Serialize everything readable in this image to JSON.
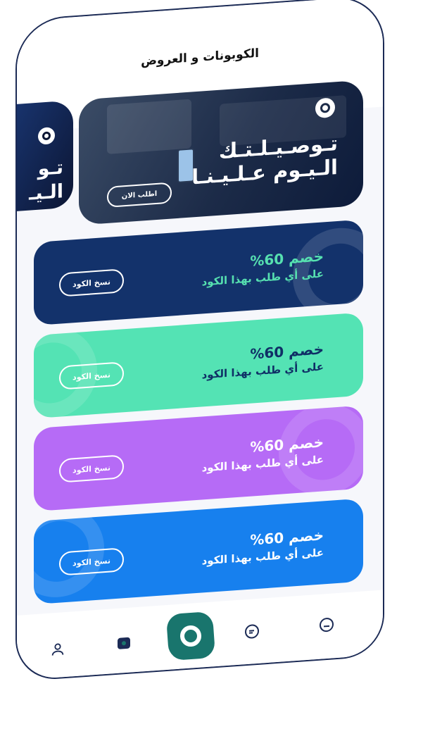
{
  "header": {
    "title": "الكوبونات و العروض"
  },
  "banners": [
    {
      "headline_line1": "تـوصـيـلـتـك",
      "headline_line2": "الـيـوم عـلـيـنـا",
      "button_label": "اطلب الان"
    },
    {
      "headline_line1": "تـو",
      "headline_line2": "الـيـ"
    }
  ],
  "coupons": [
    {
      "title": "خصم 60%",
      "subtitle": "على أي طلب بهذا الكود",
      "button_label": "نسخ الكود",
      "bg": "#13326b",
      "title_color": "#56e0b0",
      "sub_color": "#56e0b0",
      "btn_color": "#ffffff"
    },
    {
      "title": "خصم 60%",
      "subtitle": "على أي طلب بهذا الكود",
      "button_label": "نسخ الكود",
      "bg": "#54e3b4",
      "title_color": "#0f2f66",
      "sub_color": "#0f2f66",
      "btn_color": "#ffffff"
    },
    {
      "title": "خصم 60%",
      "subtitle": "على أي طلب بهذا الكود",
      "button_label": "نسخ الكود",
      "bg": "#b66bf6",
      "title_color": "#ffffff",
      "sub_color": "#ffffff",
      "btn_color": "#ffffff"
    },
    {
      "title": "خصم 60%",
      "subtitle": "على أي طلب بهذا الكود",
      "button_label": "نسخ الكود",
      "bg": "#1780ee",
      "title_color": "#ffffff",
      "sub_color": "#ffffff",
      "btn_color": "#ffffff"
    }
  ],
  "nav": {
    "items": [
      {
        "icon": "user-icon"
      },
      {
        "icon": "coupons-icon"
      },
      {
        "icon": "home-logo-icon"
      },
      {
        "icon": "chat-icon"
      },
      {
        "icon": "orders-icon"
      }
    ]
  },
  "colors": {
    "primary": "#19756d",
    "navy": "#1b2a55"
  }
}
